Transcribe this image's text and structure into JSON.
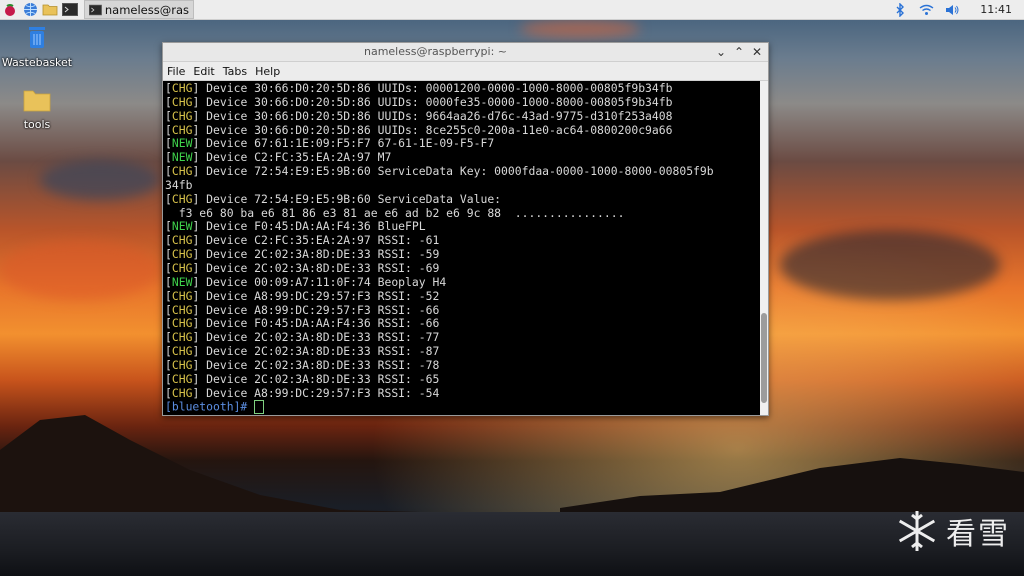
{
  "taskbar": {
    "task_label": "nameless@rasp",
    "clock": "11:41"
  },
  "desktop": {
    "icons": [
      {
        "label": "Wastebasket"
      },
      {
        "label": "tools"
      }
    ]
  },
  "window": {
    "title": "nameless@raspberrypi: ~",
    "menu": [
      "File",
      "Edit",
      "Tabs",
      "Help"
    ],
    "lines": [
      {
        "tag": "CHG",
        "text": " Device 30:66:D0:20:5D:86 UUIDs: 00001200-0000-1000-8000-00805f9b34fb"
      },
      {
        "tag": "CHG",
        "text": " Device 30:66:D0:20:5D:86 UUIDs: 0000fe35-0000-1000-8000-00805f9b34fb"
      },
      {
        "tag": "CHG",
        "text": " Device 30:66:D0:20:5D:86 UUIDs: 9664aa26-d76c-43ad-9775-d310f253a408"
      },
      {
        "tag": "CHG",
        "text": " Device 30:66:D0:20:5D:86 UUIDs: 8ce255c0-200a-11e0-ac64-0800200c9a66"
      },
      {
        "tag": "NEW",
        "text": " Device 67:61:1E:09:F5:F7 67-61-1E-09-F5-F7"
      },
      {
        "tag": "NEW",
        "text": " Device C2:FC:35:EA:2A:97 M7"
      },
      {
        "tag": "CHG",
        "text": " Device 72:54:E9:E5:9B:60 ServiceData Key: 0000fdaa-0000-1000-8000-00805f9b"
      },
      {
        "tag": "",
        "text": "34fb"
      },
      {
        "tag": "CHG",
        "text": " Device 72:54:E9:E5:9B:60 ServiceData Value:"
      },
      {
        "tag": "",
        "text": "  f3 e6 80 ba e6 81 86 e3 81 ae e6 ad b2 e6 9c 88  ................"
      },
      {
        "tag": "NEW",
        "text": " Device F0:45:DA:AA:F4:36 BlueFPL"
      },
      {
        "tag": "CHG",
        "text": " Device C2:FC:35:EA:2A:97 RSSI: -61"
      },
      {
        "tag": "CHG",
        "text": " Device 2C:02:3A:8D:DE:33 RSSI: -59"
      },
      {
        "tag": "CHG",
        "text": " Device 2C:02:3A:8D:DE:33 RSSI: -69"
      },
      {
        "tag": "NEW",
        "text": " Device 00:09:A7:11:0F:74 Beoplay H4"
      },
      {
        "tag": "CHG",
        "text": " Device A8:99:DC:29:57:F3 RSSI: -52"
      },
      {
        "tag": "CHG",
        "text": " Device A8:99:DC:29:57:F3 RSSI: -66"
      },
      {
        "tag": "CHG",
        "text": " Device F0:45:DA:AA:F4:36 RSSI: -66"
      },
      {
        "tag": "CHG",
        "text": " Device 2C:02:3A:8D:DE:33 RSSI: -77"
      },
      {
        "tag": "CHG",
        "text": " Device 2C:02:3A:8D:DE:33 RSSI: -87"
      },
      {
        "tag": "CHG",
        "text": " Device 2C:02:3A:8D:DE:33 RSSI: -78"
      },
      {
        "tag": "CHG",
        "text": " Device 2C:02:3A:8D:DE:33 RSSI: -65"
      },
      {
        "tag": "CHG",
        "text": " Device A8:99:DC:29:57:F3 RSSI: -54"
      }
    ],
    "prompt": "[bluetooth]# "
  },
  "watermark": {
    "text": "看雪"
  },
  "colors": {
    "chg": "#d7c14a",
    "new": "#3fd14b",
    "prompt": "#5b8de0"
  }
}
